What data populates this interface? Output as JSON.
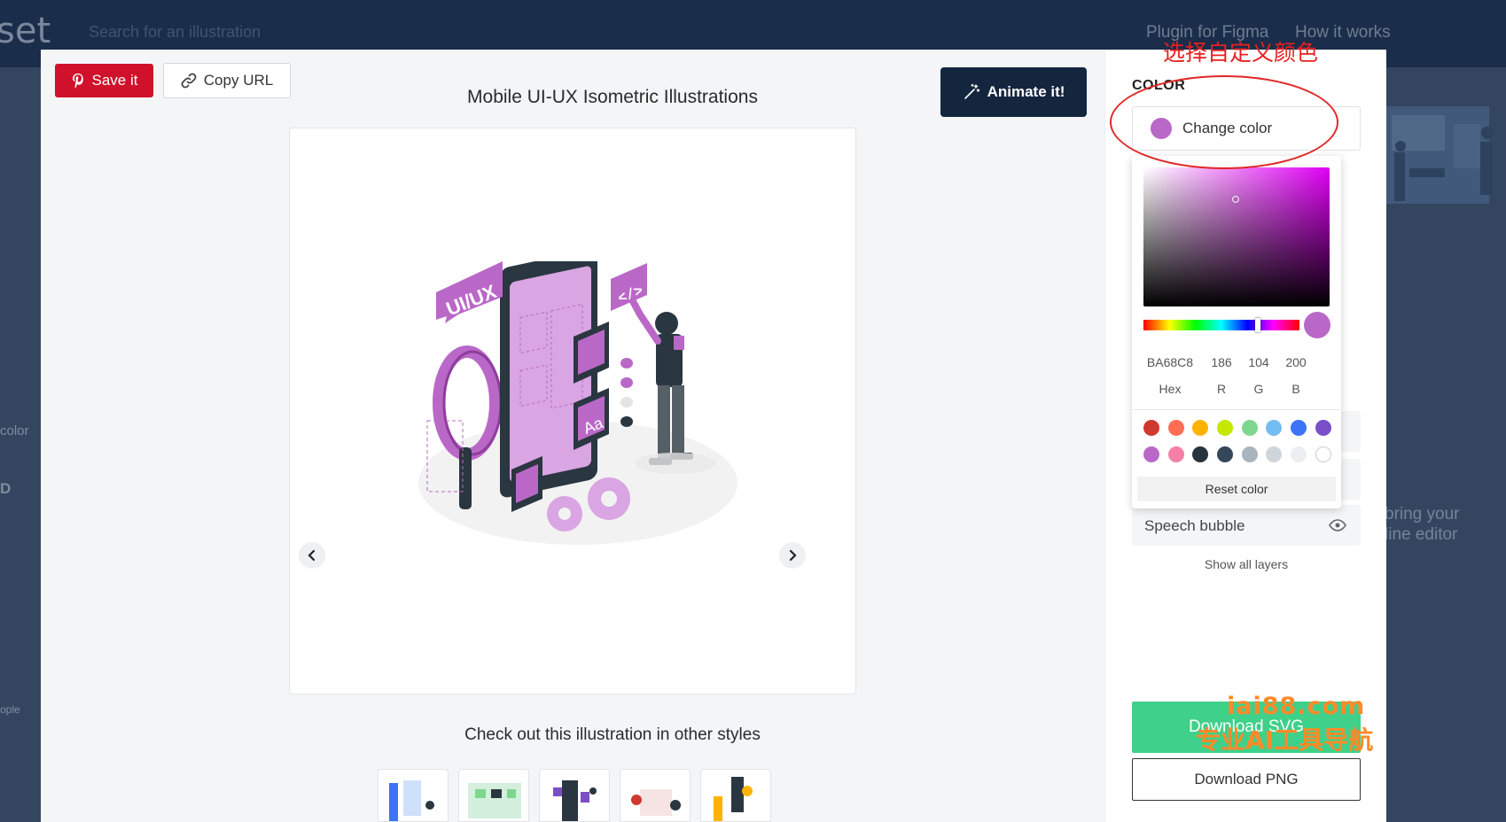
{
  "background": {
    "logo_fragment": "set",
    "search_placeholder": "Search for an illustration",
    "nav": [
      "Plugin for Figma",
      "How it works"
    ],
    "side_text_1": "color",
    "side_text_2": "D",
    "side_text_3": "ople",
    "right_text_1": "bring your",
    "right_text_2": "line editor"
  },
  "toolbar": {
    "save_label": "Save it",
    "copy_label": "Copy URL",
    "animate_label": "Animate it!"
  },
  "illustration": {
    "title": "Mobile UI-UX Isometric Illustrations",
    "uiux_text": "UI/UX",
    "code_text": "</>",
    "font_text": "Aa"
  },
  "other_styles": {
    "title": "Check out this illustration in other styles",
    "thumbs": [
      "style-1",
      "style-2",
      "style-3",
      "style-4",
      "style-5"
    ]
  },
  "color_panel": {
    "label": "COLOR",
    "annotation": "选择自定义颜色",
    "change_color_label": "Change color",
    "current_color": "#BA68C8",
    "picker": {
      "hex": "BA68C8",
      "r": "186",
      "g": "104",
      "b": "200",
      "hex_label": "Hex",
      "r_label": "R",
      "g_label": "G",
      "b_label": "B",
      "swatches": [
        "#d0392e",
        "#ff6e54",
        "#ffb300",
        "#c6e800",
        "#7ed68f",
        "#74bdf2",
        "#3d73f5",
        "#7a4fc8",
        "#ba68c8",
        "#f57fa6",
        "#27343d",
        "#35465a",
        "#a9b4bd",
        "#cfd5da",
        "#eceff1",
        "#ffffff"
      ],
      "reset_label": "Reset color"
    }
  },
  "layers": {
    "speech_bubble_label": "Speech bubble",
    "show_all_label": "Show all layers"
  },
  "downloads": {
    "svg_label": "Download SVG",
    "png_label": "Download PNG"
  },
  "watermark": {
    "site": "iai88.com",
    "tagline": "专业AI工具导航"
  }
}
